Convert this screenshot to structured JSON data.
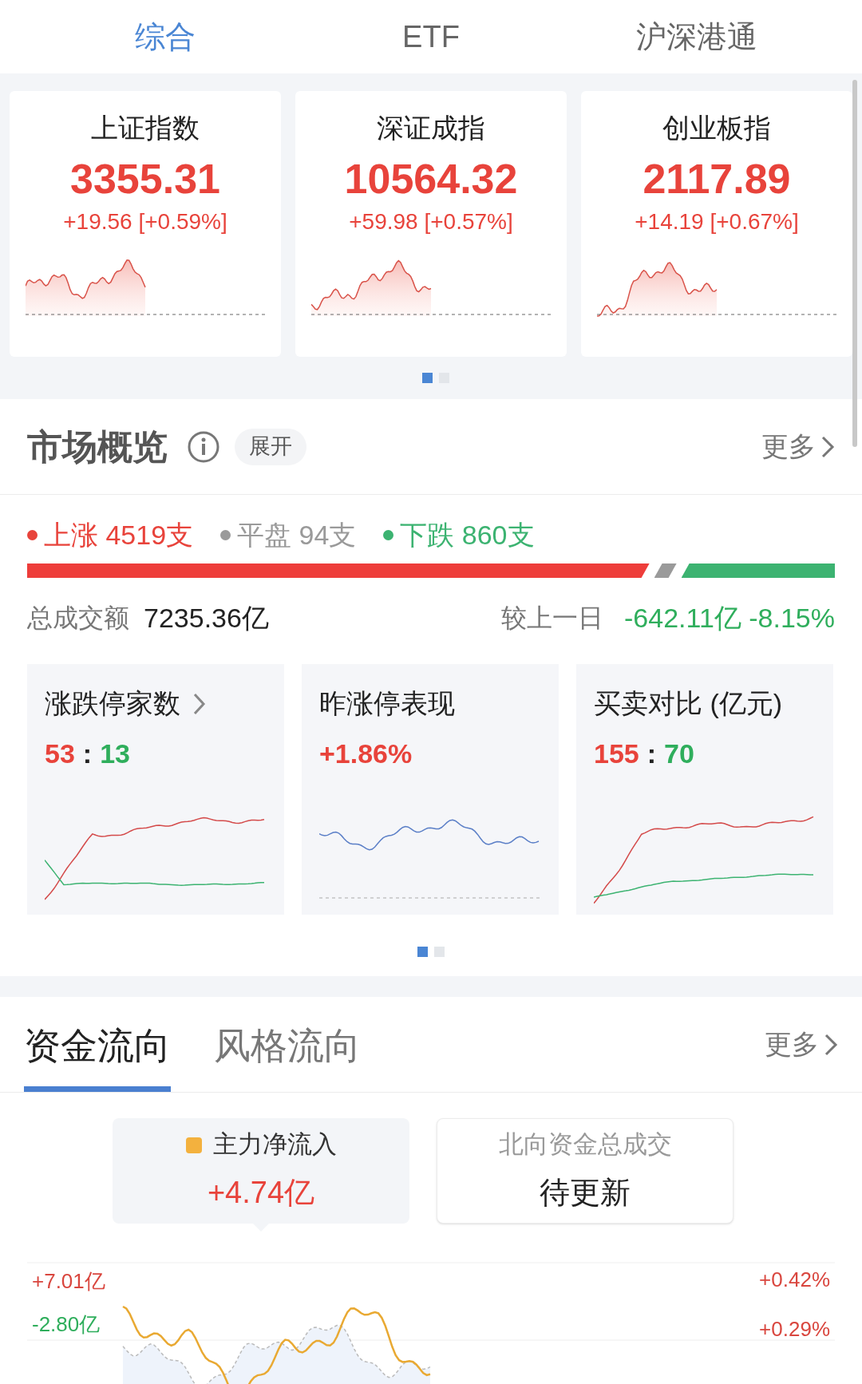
{
  "tabs": [
    {
      "label": "综合",
      "selected": true
    },
    {
      "label": "ETF",
      "selected": false
    },
    {
      "label": "沪深港通",
      "selected": false
    }
  ],
  "indices": [
    {
      "name": "上证指数",
      "price": "3355.31",
      "change": "+19.56 [+0.59%]",
      "color": "#e8433b"
    },
    {
      "name": "深证成指",
      "price": "10564.32",
      "change": "+59.98 [+0.57%]",
      "color": "#e8433b"
    },
    {
      "name": "创业板指",
      "price": "2117.89",
      "change": "+14.19 [+0.67%]",
      "color": "#e8433b"
    }
  ],
  "index_pager": [
    {
      "selected": true
    },
    {
      "selected": false
    }
  ],
  "overview": {
    "title": "市场概览",
    "expand": "展开",
    "more": "更多",
    "breadth": [
      {
        "label": "上涨 4519支",
        "color": "#e8433b"
      },
      {
        "label": "平盘 94支",
        "color": "#9a9a9a"
      },
      {
        "label": "下跌 860支",
        "color": "#3cb371"
      }
    ],
    "breadth_bar": {
      "level": 0.8
    },
    "turnover_label": "总成交额",
    "turnover": "7235.36亿",
    "compare_label": "较上一日",
    "compare": {
      "text": "-642.11亿 -8.15%",
      "color": "#2fae5c"
    },
    "cards": [
      {
        "kind": "ratio",
        "title": "涨跌停家数",
        "link": true,
        "up": "53",
        "separator": ":",
        "down": "13"
      },
      {
        "kind": "value",
        "title": "昨涨停表现",
        "link": false,
        "value": "+1.86%"
      },
      {
        "kind": "ratio",
        "title": "买卖对比 (亿元)",
        "link": false,
        "up": "155",
        "separator": ":",
        "down": "70"
      }
    ],
    "pager": [
      {
        "selected": true
      },
      {
        "selected": false
      }
    ]
  },
  "flow": {
    "tabs": [
      {
        "label": "资金流向",
        "selected": true
      },
      {
        "label": "风格流向",
        "selected": false
      }
    ],
    "more": "更多",
    "stats": [
      {
        "kind": "legend",
        "label": "主力净流入",
        "value": "+4.74亿",
        "selected": true
      },
      {
        "kind": "plain",
        "label": "北向资金总成交",
        "value": "待更新",
        "selected": false
      }
    ],
    "left_labels": [
      {
        "text": "+7.01亿",
        "color": "#d9463e"
      },
      {
        "text": "-2.80亿",
        "color": "#2fae5c"
      }
    ],
    "right_labels": [
      {
        "text": "+0.42%",
        "color": "#d9463e"
      },
      {
        "text": "+0.29%",
        "color": "#d9463e"
      }
    ]
  }
}
